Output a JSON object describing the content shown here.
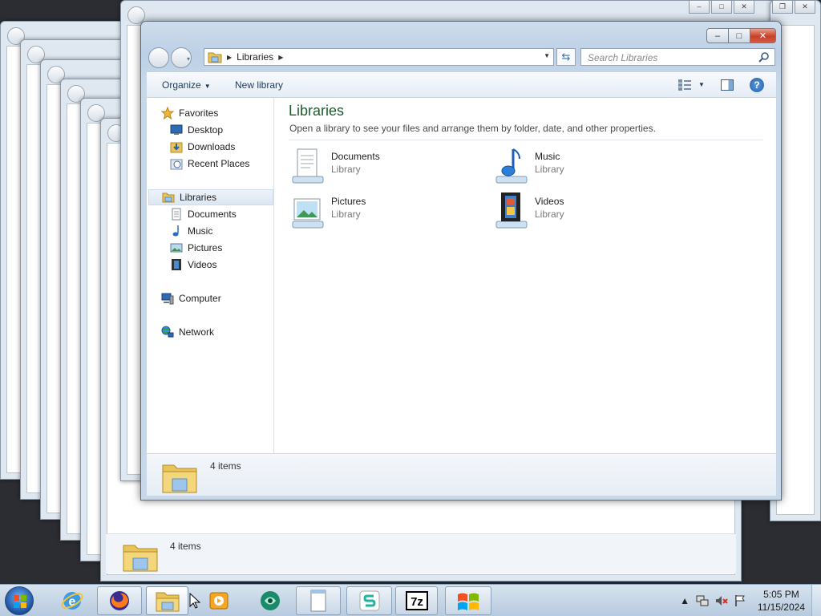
{
  "window": {
    "breadcrumb": "Libraries",
    "search_placeholder": "Search Libraries",
    "caption": {
      "minimize": "–",
      "maximize": "□",
      "close": "✕"
    }
  },
  "toolbar": {
    "organize_label": "Organize",
    "new_library_label": "New library",
    "help_label": "?"
  },
  "sidebar": {
    "favorites": {
      "label": "Favorites",
      "items": [
        "Desktop",
        "Downloads",
        "Recent Places"
      ]
    },
    "libraries": {
      "label": "Libraries",
      "items": [
        "Documents",
        "Music",
        "Pictures",
        "Videos"
      ]
    },
    "computer_label": "Computer",
    "network_label": "Network"
  },
  "content": {
    "title": "Libraries",
    "subtitle": "Open a library to see your files and arrange them by folder, date, and other properties.",
    "libraries": [
      {
        "name": "Documents",
        "kind": "Library",
        "icon": "documents-library-icon"
      },
      {
        "name": "Music",
        "kind": "Library",
        "icon": "music-library-icon"
      },
      {
        "name": "Pictures",
        "kind": "Library",
        "icon": "pictures-library-icon"
      },
      {
        "name": "Videos",
        "kind": "Library",
        "icon": "videos-library-icon"
      }
    ]
  },
  "status": {
    "item_count": "4 items"
  },
  "background_status": {
    "item_count": "4 items"
  },
  "taskbar": {
    "apps": [
      "internet-explorer-icon",
      "firefox-icon",
      "explorer-icon",
      "media-player-icon",
      "app-icon",
      "notepad-icon",
      "s-app-icon",
      "7zip-icon",
      "windows-icon"
    ],
    "sevenzip_label": "7z",
    "time": "5:05 PM",
    "date": "11/15/2024"
  },
  "colors": {
    "title_green": "#1e5c2e",
    "link_blue": "#1e3958",
    "close_red": "#c7412a"
  }
}
